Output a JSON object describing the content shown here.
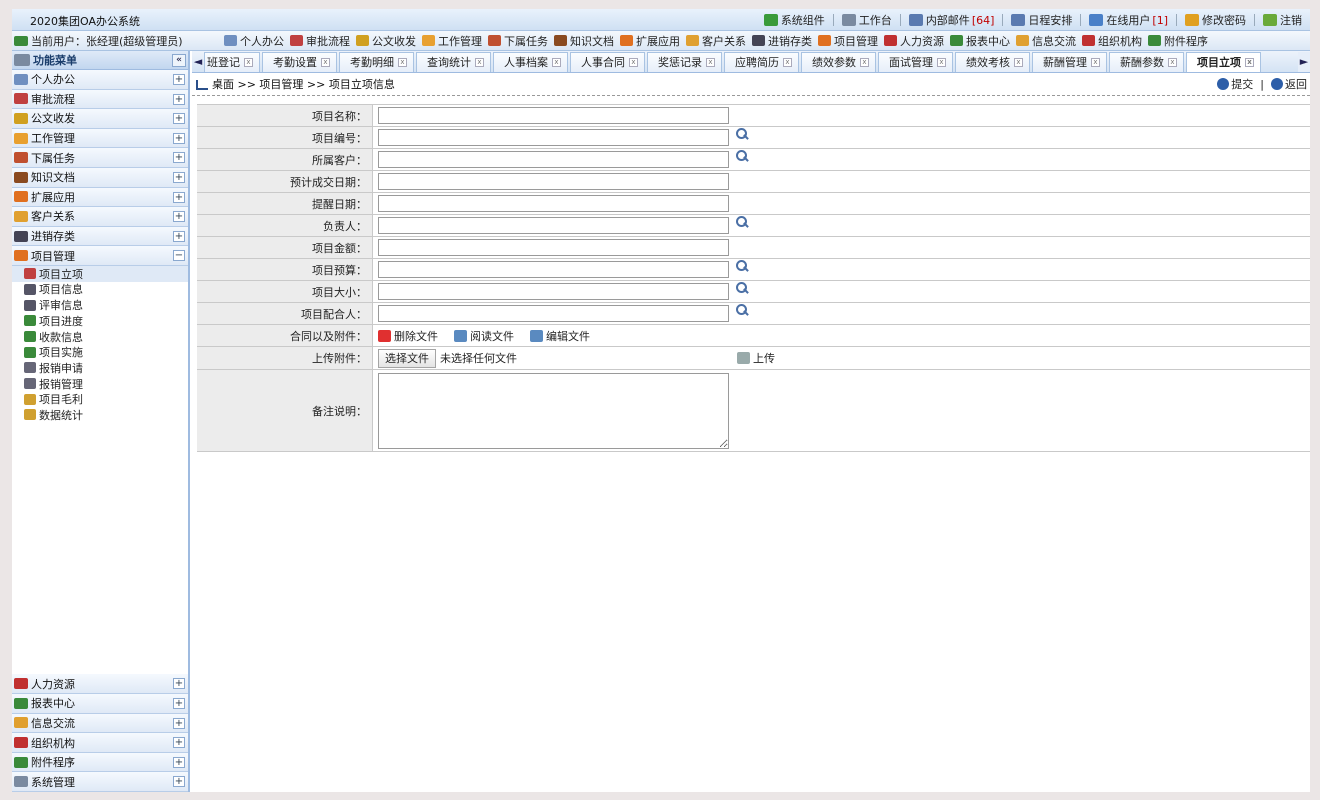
{
  "app_title": "2020集团OA办公系统",
  "top_links": [
    {
      "label": "系统组件",
      "icon": "components-icon",
      "color": "#3a9b3a"
    },
    {
      "label": "工作台",
      "icon": "home-icon",
      "color": "#7a8aa0"
    },
    {
      "label": "内部邮件",
      "count": "[64]",
      "icon": "mail-icon",
      "color": "#5a7ab0"
    },
    {
      "label": "日程安排",
      "icon": "calendar-icon",
      "color": "#5a7ab0"
    },
    {
      "label": "在线用户",
      "count": "[1]",
      "icon": "users-icon",
      "color": "#4a80c8"
    },
    {
      "label": "修改密码",
      "icon": "key-icon",
      "color": "#e0a020"
    },
    {
      "label": "注销",
      "icon": "logout-icon",
      "color": "#6aaa3a"
    }
  ],
  "user_bar": {
    "label": "当前用户：",
    "user": "张经理(超级管理员)"
  },
  "quick_menu": [
    {
      "label": "个人办公",
      "color": "#6f8fc0"
    },
    {
      "label": "审批流程",
      "color": "#c04040"
    },
    {
      "label": "公文收发",
      "color": "#d0a020"
    },
    {
      "label": "工作管理",
      "color": "#e8a030"
    },
    {
      "label": "下属任务",
      "color": "#c05030"
    },
    {
      "label": "知识文档",
      "color": "#8a4a20"
    },
    {
      "label": "扩展应用",
      "color": "#e07020"
    },
    {
      "label": "客户关系",
      "color": "#e0a030"
    },
    {
      "label": "进销存类",
      "color": "#445"
    },
    {
      "label": "项目管理",
      "color": "#e07020"
    },
    {
      "label": "人力资源",
      "color": "#c03030"
    },
    {
      "label": "报表中心",
      "color": "#3a8a3a"
    },
    {
      "label": "信息交流",
      "color": "#e0a030"
    },
    {
      "label": "组织机构",
      "color": "#c03030"
    },
    {
      "label": "附件程序",
      "color": "#3a8a3a"
    }
  ],
  "sidebar": {
    "title": "功能菜单",
    "collapse": "«",
    "expand_symbol": "+",
    "collapse_symbol": "−",
    "menus": [
      {
        "label": "个人办公",
        "color": "#6f8fc0"
      },
      {
        "label": "审批流程",
        "color": "#c04040"
      },
      {
        "label": "公文收发",
        "color": "#d0a020"
      },
      {
        "label": "工作管理",
        "color": "#e8a030"
      },
      {
        "label": "下属任务",
        "color": "#c05030"
      },
      {
        "label": "知识文档",
        "color": "#8a4a20"
      },
      {
        "label": "扩展应用",
        "color": "#e07020"
      },
      {
        "label": "客户关系",
        "color": "#e0a030"
      },
      {
        "label": "进销存类",
        "color": "#445"
      }
    ],
    "open_menu": {
      "label": "项目管理",
      "color": "#e07020"
    },
    "sub_items": [
      {
        "label": "项目立项",
        "color": "#c04040"
      },
      {
        "label": "项目信息",
        "color": "#556"
      },
      {
        "label": "评审信息",
        "color": "#556"
      },
      {
        "label": "项目进度",
        "color": "#3a8a3a"
      },
      {
        "label": "收款信息",
        "color": "#3a8a3a"
      },
      {
        "label": "项目实施",
        "color": "#3a8a3a"
      },
      {
        "label": "报销申请",
        "color": "#667"
      },
      {
        "label": "报销管理",
        "color": "#667"
      },
      {
        "label": "项目毛利",
        "color": "#d0a030"
      },
      {
        "label": "数据统计",
        "color": "#d0a030"
      }
    ],
    "bottom_menus": [
      {
        "label": "人力资源",
        "color": "#c03030"
      },
      {
        "label": "报表中心",
        "color": "#3a8a3a"
      },
      {
        "label": "信息交流",
        "color": "#e0a030"
      },
      {
        "label": "组织机构",
        "color": "#c03030"
      },
      {
        "label": "附件程序",
        "color": "#3a8a3a"
      },
      {
        "label": "系统管理",
        "color": "#7a8aa0"
      }
    ]
  },
  "tabs": {
    "left_arrow": "◄",
    "right_arrow": "►",
    "close_glyph": "x",
    "items": [
      "班登记",
      "考勤设置",
      "考勤明细",
      "查询统计",
      "人事档案",
      "人事合同",
      "奖惩记录",
      "应聘简历",
      "绩效参数",
      "面试管理",
      "绩效考核",
      "薪酬管理",
      "薪酬参数",
      "项目立项"
    ],
    "active": "项目立项"
  },
  "breadcrumb": "桌面 >> 项目管理 >> 项目立项信息",
  "actions": {
    "submit": "提交",
    "separator": "|",
    "back": "返回"
  },
  "form": {
    "fields": [
      {
        "label": "项目名称：",
        "value": "",
        "lookup": false
      },
      {
        "label": "项目编号：",
        "value": "",
        "lookup": true
      },
      {
        "label": "所属客户：",
        "value": "",
        "lookup": true
      },
      {
        "label": "预计成交日期：",
        "value": "",
        "lookup": false
      },
      {
        "label": "提醒日期：",
        "value": "",
        "lookup": false
      },
      {
        "label": "负责人：",
        "value": "",
        "lookup": true
      },
      {
        "label": "项目金额：",
        "value": "",
        "lookup": false
      },
      {
        "label": "项目预算：",
        "value": "",
        "lookup": true
      },
      {
        "label": "项目大小：",
        "value": "",
        "lookup": true
      },
      {
        "label": "项目配合人：",
        "value": "",
        "lookup": true
      }
    ],
    "attachments": {
      "label": "合同以及附件：",
      "delete": "删除文件",
      "read": "阅读文件",
      "edit": "编辑文件"
    },
    "upload": {
      "label": "上传附件：",
      "choose": "选择文件",
      "no_file": "未选择任何文件",
      "upload": "上传"
    },
    "remarks": {
      "label": "备注说明：",
      "value": ""
    }
  }
}
